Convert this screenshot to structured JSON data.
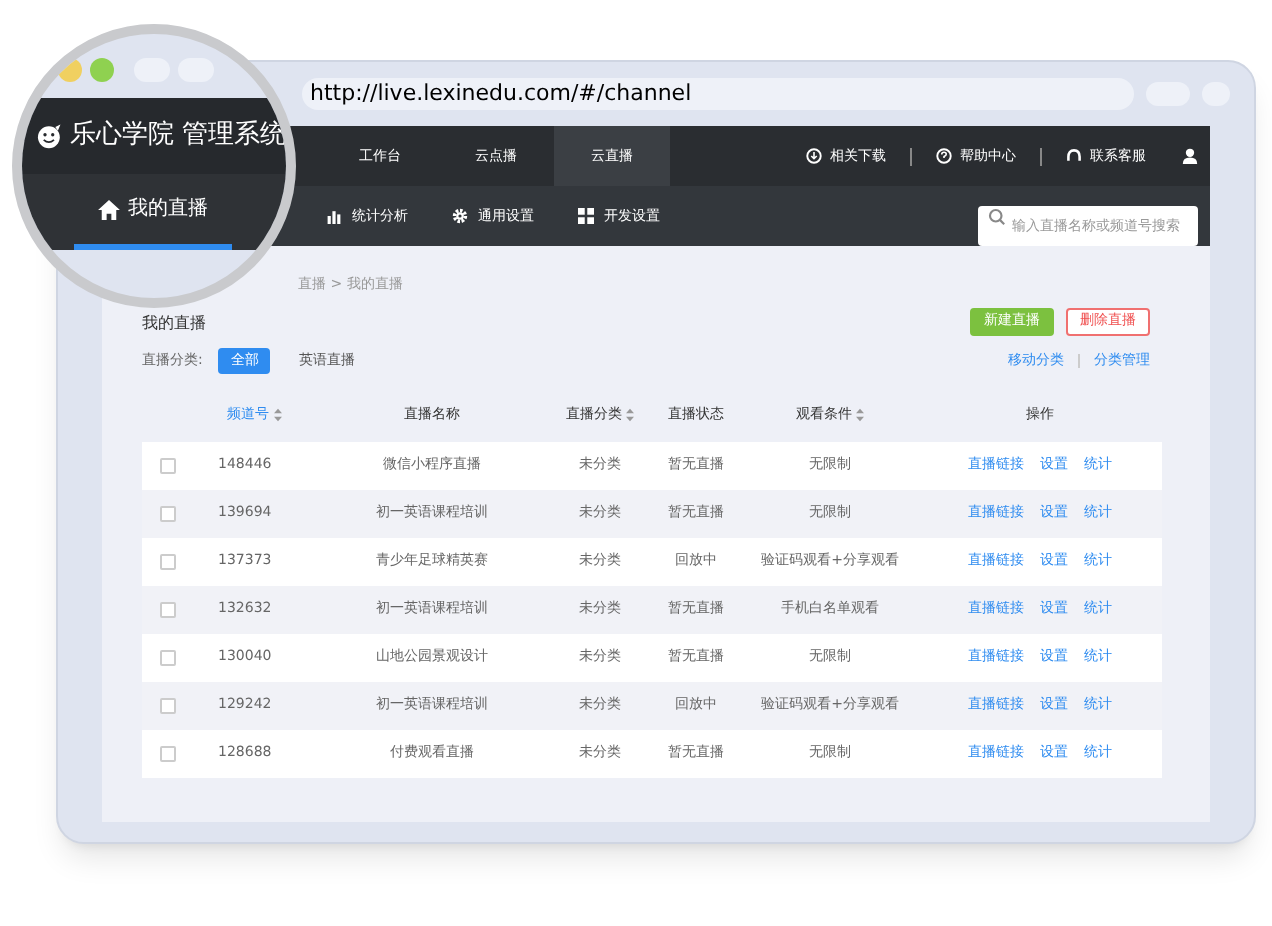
{
  "browser": {
    "url": "http://live.lexinedu.com/#/channel"
  },
  "magnifier": {
    "logo_text": "乐心学院 管理系统",
    "tab": {
      "label": "我的直播",
      "selected": true
    }
  },
  "top_nav": [
    {
      "label": "工作台",
      "selected": false
    },
    {
      "label": "云点播",
      "selected": false
    },
    {
      "label": "云直播",
      "selected": true
    }
  ],
  "top_links": [
    {
      "kind": "download",
      "label": "相关下载"
    },
    {
      "kind": "help",
      "label": "帮助中心"
    },
    {
      "kind": "service",
      "label": "联系客服"
    }
  ],
  "sub_nav": [
    {
      "kind": "chart",
      "label": "统计分析"
    },
    {
      "kind": "gear",
      "label": "通用设置"
    },
    {
      "kind": "grid",
      "label": "开发设置"
    }
  ],
  "search": {
    "placeholder": "输入直播名称或频道号搜索"
  },
  "breadcrumb": "直播 > 我的直播",
  "page_title": "我的直播",
  "buttons": [
    {
      "kind": "primary",
      "label": "新建直播"
    },
    {
      "kind": "danger",
      "label": "删除直播"
    }
  ],
  "filter": {
    "label": "直播分类:",
    "options": [
      {
        "label": "全部",
        "selected": true
      },
      {
        "label": "英语直播",
        "selected": false
      }
    ],
    "links": [
      "移动分类",
      "分类管理"
    ]
  },
  "table": {
    "columns": [
      {
        "label": "频道号",
        "sortable": true,
        "sorted": true
      },
      {
        "label": "直播名称",
        "sortable": false,
        "sorted": false
      },
      {
        "label": "直播分类",
        "sortable": true,
        "sorted": false
      },
      {
        "label": "直播状态",
        "sortable": false,
        "sorted": false
      },
      {
        "label": "观看条件",
        "sortable": true,
        "sorted": false
      },
      {
        "label": "操作",
        "sortable": false,
        "sorted": false
      }
    ],
    "rows": [
      {
        "checked": false,
        "cells": [
          "148446",
          "微信小程序直播",
          "未分类",
          "暂无直播",
          "无限制"
        ],
        "actions": [
          "直播链接",
          "设置",
          "统计"
        ]
      },
      {
        "checked": false,
        "cells": [
          "139694",
          "初一英语课程培训",
          "未分类",
          "暂无直播",
          "无限制"
        ],
        "actions": [
          "直播链接",
          "设置",
          "统计"
        ]
      },
      {
        "checked": false,
        "cells": [
          "137373",
          "青少年足球精英赛",
          "未分类",
          "回放中",
          "验证码观看+分享观看"
        ],
        "actions": [
          "直播链接",
          "设置",
          "统计"
        ]
      },
      {
        "checked": false,
        "cells": [
          "132632",
          "初一英语课程培训",
          "未分类",
          "暂无直播",
          "手机白名单观看"
        ],
        "actions": [
          "直播链接",
          "设置",
          "统计"
        ]
      },
      {
        "checked": false,
        "cells": [
          "130040",
          "山地公园景观设计",
          "未分类",
          "暂无直播",
          "无限制"
        ],
        "actions": [
          "直播链接",
          "设置",
          "统计"
        ]
      },
      {
        "checked": false,
        "cells": [
          "129242",
          "初一英语课程培训",
          "未分类",
          "回放中",
          "验证码观看+分享观看"
        ],
        "actions": [
          "直播链接",
          "设置",
          "统计"
        ]
      },
      {
        "checked": false,
        "cells": [
          "128688",
          "付费观看直播",
          "未分类",
          "暂无直播",
          "无限制"
        ],
        "actions": [
          "直播链接",
          "设置",
          "统计"
        ]
      }
    ]
  }
}
